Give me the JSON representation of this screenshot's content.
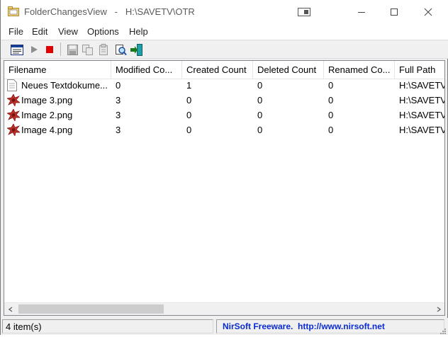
{
  "window": {
    "title": "FolderChangesView   -   H:\\SAVETV\\OTR"
  },
  "menu": [
    "File",
    "Edit",
    "View",
    "Options",
    "Help"
  ],
  "toolbar": {
    "buttons": [
      "properties-icon",
      "play-icon",
      "stop-icon",
      "save-icon",
      "copy-icon",
      "html-report-icon",
      "find-icon",
      "exit-icon"
    ]
  },
  "list": {
    "columns": [
      "Filename",
      "Modified Co...",
      "Created Count",
      "Deleted Count",
      "Renamed Co...",
      "Full Path"
    ],
    "rows": [
      {
        "icon": "text-file-icon",
        "filename": "Neues Textdokume...",
        "modified": "0",
        "created": "1",
        "deleted": "0",
        "renamed": "0",
        "path": "H:\\SAVETV\\"
      },
      {
        "icon": "image-file-icon",
        "filename": "Image 3.png",
        "modified": "3",
        "created": "0",
        "deleted": "0",
        "renamed": "0",
        "path": "H:\\SAVETV\\"
      },
      {
        "icon": "image-file-icon",
        "filename": "Image 2.png",
        "modified": "3",
        "created": "0",
        "deleted": "0",
        "renamed": "0",
        "path": "H:\\SAVETV\\"
      },
      {
        "icon": "image-file-icon",
        "filename": "Image 4.png",
        "modified": "3",
        "created": "0",
        "deleted": "0",
        "renamed": "0",
        "path": "H:\\SAVETV\\"
      }
    ]
  },
  "status": {
    "items": "4 item(s)",
    "credit": "NirSoft Freeware.  http://www.nirsoft.net"
  },
  "colors": {
    "stop": "#e00000",
    "link": "#0a2bd2"
  }
}
